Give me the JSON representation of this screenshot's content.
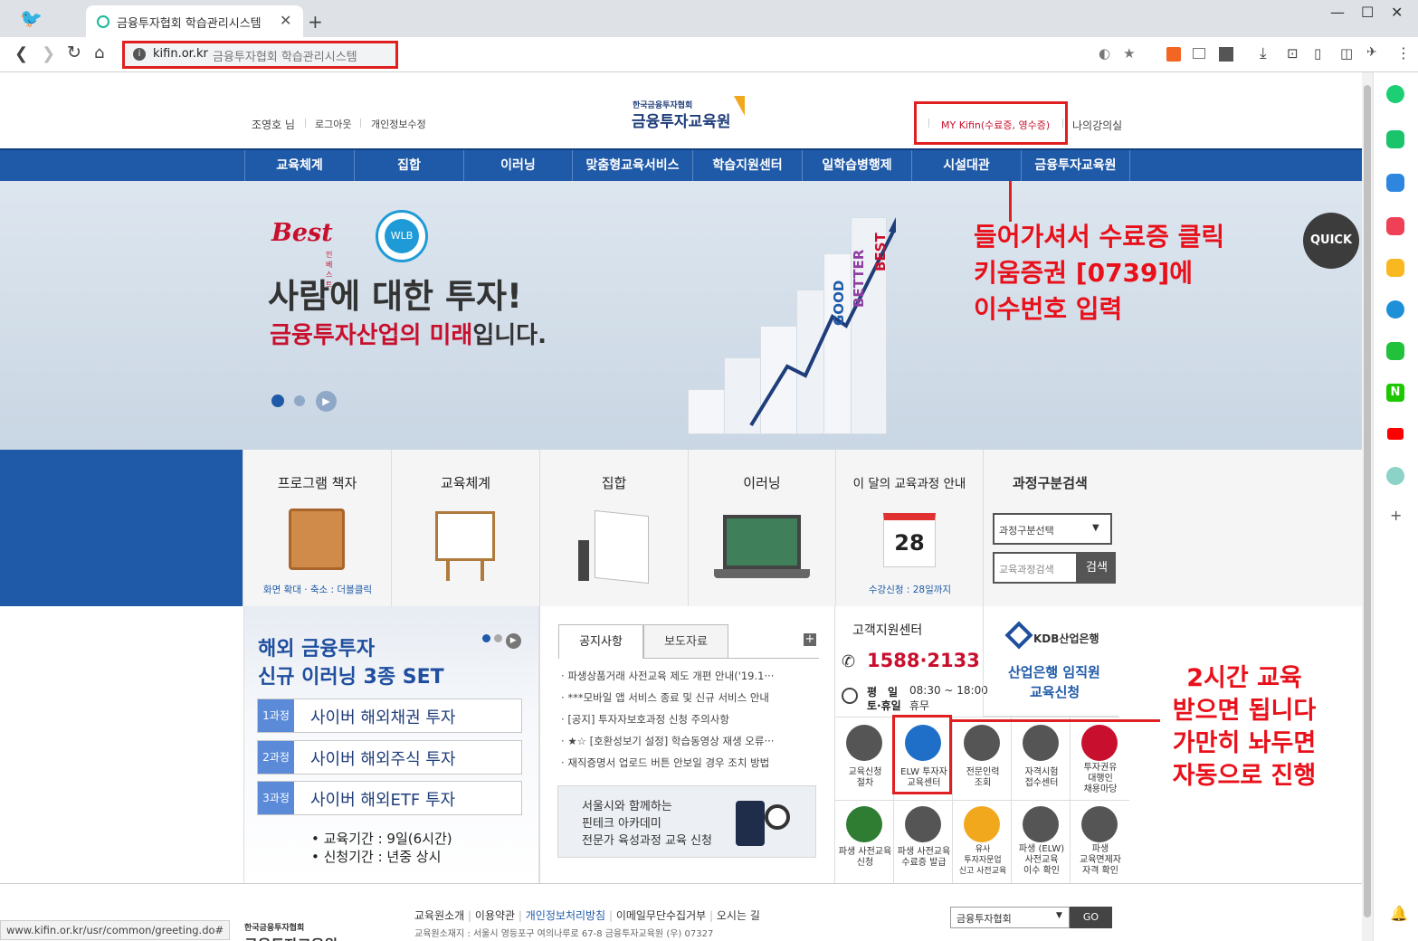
{
  "browser": {
    "tab_title": "금융투자협회 학습관리시스템",
    "url_domain": "kifin.or.kr",
    "url_title": "금융투자협회 학습관리시스템",
    "status_url": "www.kifin.or.kr/usr/common/greeting.do#"
  },
  "header": {
    "user": "조영호 님",
    "logout": "로그아웃",
    "privacy_edit": "개인정보수정",
    "logo_top": "한국금융투자협회",
    "logo_main": "금융투자교육원",
    "my_kifin": "MY Kifin(수료증, 영수증)",
    "my_classroom": "나의강의실"
  },
  "nav": [
    "교육체계",
    "집합",
    "이러닝",
    "맞춤형교육서비스",
    "학습지원센터",
    "일학습병행제",
    "시설대관",
    "금융투자교육원"
  ],
  "banner": {
    "brand": "Best",
    "brand_sub": "인베스트",
    "wlb": "WLB",
    "headline": "사람에 대한 투자!",
    "sub_red": "금융투자산업의 미래",
    "sub_tail": "입니다.",
    "chart_words": [
      "GOOD",
      "BETTER",
      "BEST"
    ]
  },
  "annotation_top": [
    "들어가셔서 수료증 클릭",
    "키움증권 [0739]에",
    "이수번호 입력"
  ],
  "annotation_bottom": [
    "2시간 교육",
    "받으면 됩니다",
    "가만히 놔두면",
    "자동으로 진행"
  ],
  "quick": "QUICK",
  "tiles": [
    {
      "title": "프로그램 책자",
      "caption": "화면 확대 · 축소 : 더블클릭"
    },
    {
      "title": "교육체계",
      "caption": ""
    },
    {
      "title": "집합",
      "caption": ""
    },
    {
      "title": "이러닝",
      "caption": ""
    },
    {
      "title": "이 달의 교육과정 안내",
      "caption": "수강신청 : 28일까지",
      "day": "28"
    }
  ],
  "search": {
    "title": "과정구분검색",
    "select_value": "과정구분선택",
    "input_placeholder": "교육과정검색",
    "button": "검색"
  },
  "promo": {
    "title_line1": "해외 금융투자",
    "title_line2": "신규 이러닝 3종 SET",
    "courses": [
      {
        "badge": "1과정",
        "name": "사이버 해외채권 투자"
      },
      {
        "badge": "2과정",
        "name": "사이버 해외주식 투자"
      },
      {
        "badge": "3과정",
        "name": "사이버 해외ETF 투자"
      }
    ],
    "period": "교육기간 : 9일(6시간)",
    "apply": "신청기간 : 년중 상시"
  },
  "notice": {
    "tabs": [
      "공지사항",
      "보도자료"
    ],
    "items": [
      "파생상품거래 사전교육 제도 개편 안내('19.1···",
      "***모바일 앱 서비스 종료 및 신규 서비스 안내",
      "[공지] 투자자보호과정 신청 주의사항",
      "★☆ [호환성보기 설정] 학습동영상 재생 오류···",
      "재직증명서 업로드 버튼 안보일 경우 조치 방법"
    ],
    "fintech": [
      "서울시와 함께하는",
      "핀테크 아카데미",
      "전문가 육성과정 교육 신청"
    ]
  },
  "support": {
    "title": "고객지원센터",
    "phone": "1588·2133",
    "weekday_label": "평　일",
    "weekday_hours": "08:30 ~ 18:00",
    "weekend_label": "토·휴일",
    "weekend_hours": "휴무"
  },
  "kdb": {
    "logo": "KDB산업은행",
    "line1": "산업은행 임직원",
    "line2": "교육신청"
  },
  "services": [
    [
      "교육신청",
      "절차"
    ],
    [
      "ELW 투자자",
      "교육센터"
    ],
    [
      "전문인력",
      "조회"
    ],
    [
      "자격시험",
      "접수센터"
    ],
    [
      "투자권유",
      "대행인",
      "채용마당"
    ],
    [
      "파생 사전교육",
      "신청"
    ],
    [
      "파생 사전교육",
      "수료증 발급"
    ],
    [
      "유사",
      "투자자문업",
      "신고 사전교육"
    ],
    [
      "파생 (ELW)",
      "사전교육",
      "이수 확인"
    ],
    [
      "파생",
      "교육면제자",
      "자격 확인"
    ]
  ],
  "footer": {
    "links": [
      "교육원소개",
      "이용약관",
      "개인정보처리방침",
      "이메일무단수집거부",
      "오시는 길"
    ],
    "address": "교육원소재지 : 서울시 영등포구 여의나루로 67-8 금융투자교육원 (우) 07327",
    "select": "금융투자협회",
    "go": "GO",
    "logo_top": "한국금융투자협회",
    "logo_main": "금융투자교육원"
  },
  "colors": {
    "nav": "#1f5aa8",
    "annotation": "#e8101a",
    "accent_red": "#c8102e"
  }
}
